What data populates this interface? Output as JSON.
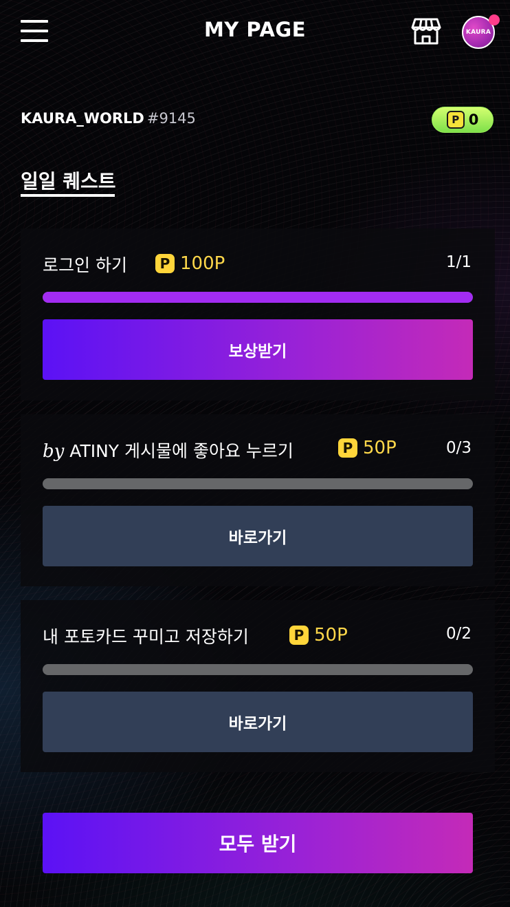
{
  "header": {
    "title": "MY PAGE",
    "avatar_text": "KAURA"
  },
  "user": {
    "name": "KAURA_WORLD",
    "tag": "#9145",
    "points": "0"
  },
  "section": {
    "tab_label": "일일 퀘스트"
  },
  "quests": [
    {
      "title": "로그인 하기",
      "reward": "100P",
      "progress_text": "1/1",
      "progress": 1.0,
      "button": "보상받기"
    },
    {
      "title_prefix": "by",
      "title": "ATINY 게시물에 좋아요 누르기",
      "reward": "50P",
      "progress_text": "0/3",
      "progress": 0.0,
      "button": "바로가기"
    },
    {
      "title": "내 포토카드 꾸미고 저장하기",
      "reward": "50P",
      "progress_text": "0/2",
      "progress": 0.0,
      "button": "바로가기"
    }
  ],
  "claim_all": "모두 받기",
  "icons": {
    "menu": "hamburger-menu-icon",
    "store": "store-icon",
    "coin": "p-coin-icon"
  },
  "colors": {
    "accent_start": "#5b12f5",
    "accent_end": "#c42ab8",
    "progress_fill": "#a22cf2",
    "reward_text": "#ffd84a",
    "points_pill": "#9af05a",
    "secondary_button": "#323f57"
  }
}
